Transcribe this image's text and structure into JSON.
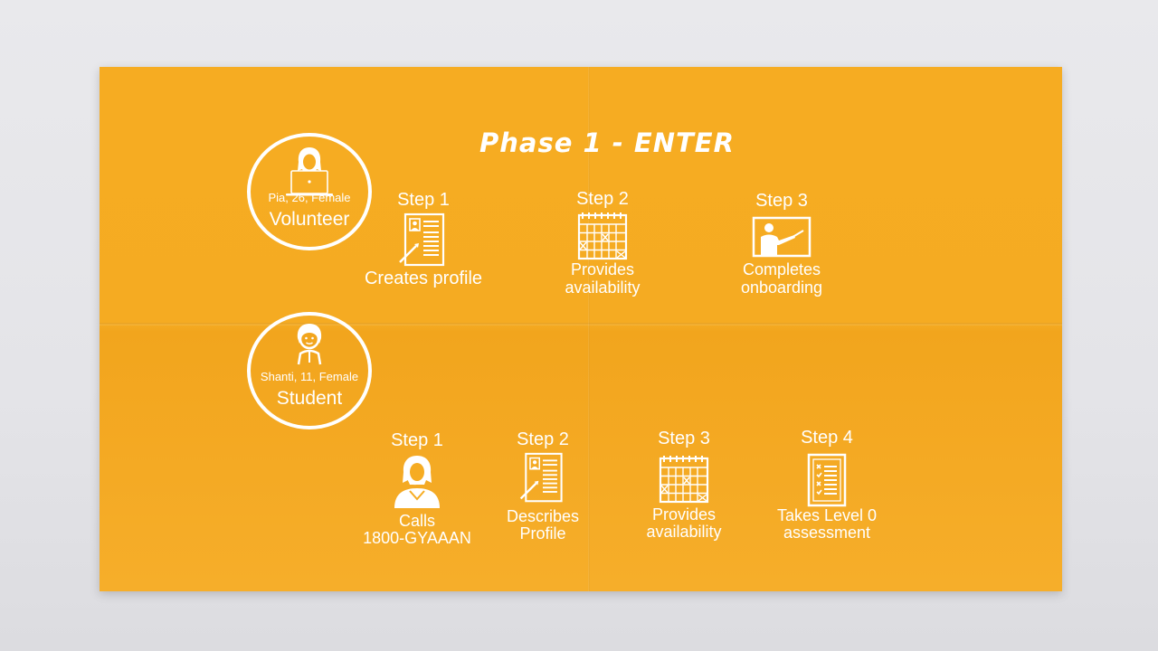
{
  "title": "Phase 1 - ENTER",
  "volunteer": {
    "meta": "Pia, 26, Female",
    "role": "Volunteer",
    "steps": [
      {
        "num": "Step 1",
        "label": "Creates profile",
        "icon": "profile-document-icon"
      },
      {
        "num": "Step 2",
        "label": "Provides\navailability",
        "icon": "calendar-icon"
      },
      {
        "num": "Step 3",
        "label": "Completes\nonboarding",
        "icon": "teacher-board-icon"
      }
    ]
  },
  "student": {
    "meta": "Shanti, 11, Female",
    "role": "Student",
    "steps": [
      {
        "num": "Step 1",
        "label": "Calls\n1800-GYAAAN",
        "icon": "call-center-agent-icon"
      },
      {
        "num": "Step 2",
        "label": "Describes\nProfile",
        "icon": "profile-document-icon"
      },
      {
        "num": "Step 3",
        "label": "Provides\navailability",
        "icon": "calendar-icon"
      },
      {
        "num": "Step 4",
        "label": "Takes Level 0\nassessment",
        "icon": "checklist-icon"
      }
    ]
  },
  "colors": {
    "paper": "#f6ac22",
    "foreground": "#ffffff",
    "background": "#e6e6ea"
  }
}
